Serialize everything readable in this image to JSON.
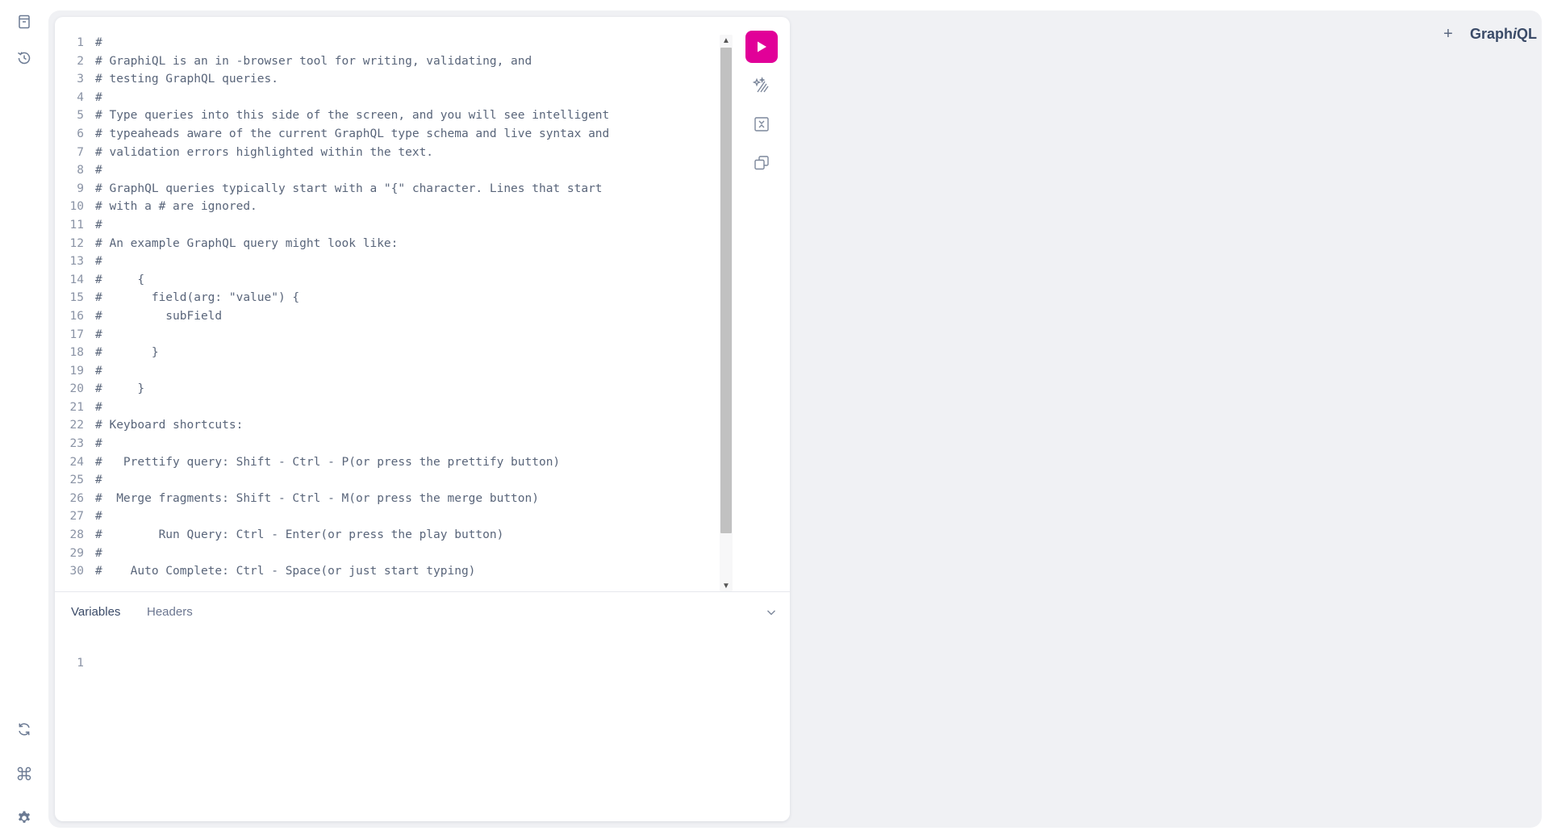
{
  "sidebar": {
    "top": [
      {
        "name": "documentation-icon"
      },
      {
        "name": "history-icon"
      }
    ],
    "bottom": [
      {
        "name": "refetch-schema-icon"
      },
      {
        "name": "keyboard-shortcuts-icon"
      },
      {
        "name": "settings-icon"
      }
    ]
  },
  "editor": {
    "lines": [
      {
        "n": "1",
        "text": "#"
      },
      {
        "n": "2",
        "text": "# GraphiQL is an in -browser tool for writing, validating, and"
      },
      {
        "n": "3",
        "text": "# testing GraphQL queries."
      },
      {
        "n": "4",
        "text": "#"
      },
      {
        "n": "5",
        "text": "# Type queries into this side of the screen, and you will see intelligent"
      },
      {
        "n": "6",
        "text": "# typeaheads aware of the current GraphQL type schema and live syntax and"
      },
      {
        "n": "7",
        "text": "# validation errors highlighted within the text."
      },
      {
        "n": "8",
        "text": "#"
      },
      {
        "n": "9",
        "text": "# GraphQL queries typically start with a \"{\" character. Lines that start"
      },
      {
        "n": "10",
        "text": "# with a # are ignored."
      },
      {
        "n": "11",
        "text": "#"
      },
      {
        "n": "12",
        "text": "# An example GraphQL query might look like:"
      },
      {
        "n": "13",
        "text": "#"
      },
      {
        "n": "14",
        "text": "#     {"
      },
      {
        "n": "15",
        "text": "#       field(arg: \"value\") {"
      },
      {
        "n": "16",
        "text": "#         subField"
      },
      {
        "n": "17",
        "text": "#"
      },
      {
        "n": "18",
        "text": "#       }"
      },
      {
        "n": "19",
        "text": "#"
      },
      {
        "n": "20",
        "text": "#     }"
      },
      {
        "n": "21",
        "text": "#"
      },
      {
        "n": "22",
        "text": "# Keyboard shortcuts:"
      },
      {
        "n": "23",
        "text": "#"
      },
      {
        "n": "24",
        "text": "#   Prettify query: Shift - Ctrl - P(or press the prettify button)"
      },
      {
        "n": "25",
        "text": "#"
      },
      {
        "n": "26",
        "text": "#  Merge fragments: Shift - Ctrl - M(or press the merge button)"
      },
      {
        "n": "27",
        "text": "#"
      },
      {
        "n": "28",
        "text": "#        Run Query: Ctrl - Enter(or press the play button)"
      },
      {
        "n": "29",
        "text": "#"
      },
      {
        "n": "30",
        "text": "#    Auto Complete: Ctrl - Space(or just start typing)"
      }
    ]
  },
  "toolbar": {
    "run": {
      "icon": "play-icon"
    },
    "prettify": {
      "icon": "prettify-icon"
    },
    "merge": {
      "icon": "merge-icon"
    },
    "copy": {
      "icon": "copy-icon"
    }
  },
  "tabs": {
    "variables_label": "Variables",
    "headers_label": "Headers"
  },
  "variables_editor": {
    "lines": [
      {
        "n": "1",
        "text": ""
      }
    ]
  },
  "header": {
    "new_tab_symbol": "+",
    "logo_prefix": "Graph",
    "logo_italic": "i",
    "logo_suffix": "QL"
  },
  "colors": {
    "accent": "#e10098",
    "shell_bg": "#f0f1f4",
    "text": "#3b4b68"
  }
}
